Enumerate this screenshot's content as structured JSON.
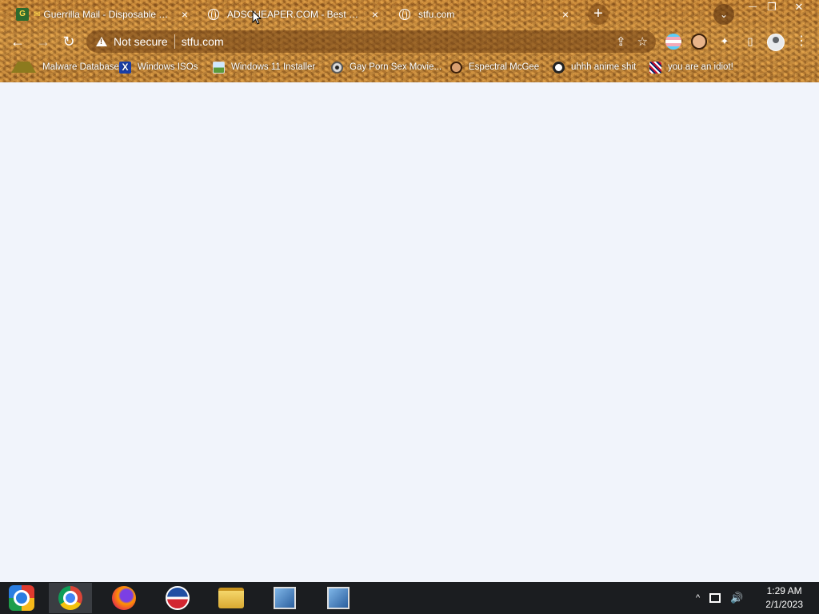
{
  "tabs": [
    {
      "title": "Guerrilla Mail - Disposable Temp",
      "close": "×"
    },
    {
      "title": "ADSCHEAPER.COM - Best online",
      "close": "×"
    },
    {
      "title": "stfu.com",
      "close": "×"
    }
  ],
  "tabstrip": {
    "new_tab": "+",
    "tab_search": "⌄"
  },
  "window_controls": {
    "minimize": "—",
    "restore": "❐",
    "close": "✕"
  },
  "toolbar": {
    "back": "←",
    "forward": "→",
    "reload": "↻",
    "security_text": "Not secure",
    "url": "stfu.com",
    "share": "⇪",
    "bookmark_star": "☆",
    "extensions": "✦",
    "side_panel": "▯",
    "menu": "⋮"
  },
  "bookmarks": [
    {
      "label": "Malware Database",
      "icon": "warning-icon"
    },
    {
      "label": "Windows ISOs",
      "icon": "x-icon"
    },
    {
      "label": "Windows 11 Installer",
      "icon": "image-icon"
    },
    {
      "label": "Gay Porn Sex Movie...",
      "icon": "disc-icon"
    },
    {
      "label": "Espectral McGee",
      "icon": "face-icon"
    },
    {
      "label": "uhhh anime shit",
      "icon": "anime-icon"
    },
    {
      "label": "you are an idiot!",
      "icon": "flag-icon"
    }
  ],
  "taskbar": {
    "apps": [
      {
        "name": "start-button"
      },
      {
        "name": "chrome"
      },
      {
        "name": "firefox"
      },
      {
        "name": "obama"
      },
      {
        "name": "file-explorer"
      },
      {
        "name": "installer-1"
      },
      {
        "name": "installer-2"
      }
    ],
    "tray_chevron": "^",
    "time": "1:29 AM",
    "date": "2/1/2023"
  },
  "colors": {
    "accent": "#c48a3c",
    "page_bg": "#f1f4fb",
    "taskbar": "#1b1d20"
  }
}
